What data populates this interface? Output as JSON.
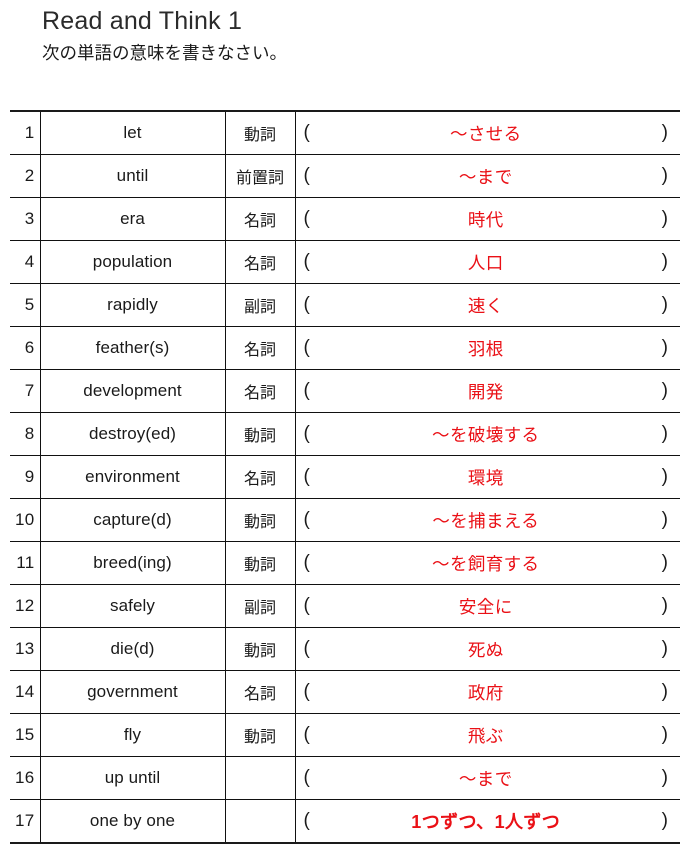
{
  "header": {
    "title": "Read and Think 1",
    "subtitle": "次の単語の意味を書きなさい。"
  },
  "style": {
    "answer_color": "#ea1016",
    "text_color": "#1a1a1a",
    "border_color": "#111111"
  },
  "table": {
    "paren_open": "(",
    "paren_close": ")",
    "rows": [
      {
        "num": "1",
        "word": "let",
        "pos": "動詞",
        "answer": "〜させる",
        "bold": false
      },
      {
        "num": "2",
        "word": "until",
        "pos": "前置詞",
        "answer": "〜まで",
        "bold": false
      },
      {
        "num": "3",
        "word": "era",
        "pos": "名詞",
        "answer": "時代",
        "bold": false
      },
      {
        "num": "4",
        "word": "population",
        "pos": "名詞",
        "answer": "人口",
        "bold": false
      },
      {
        "num": "5",
        "word": "rapidly",
        "pos": "副詞",
        "answer": "速く",
        "bold": false
      },
      {
        "num": "6",
        "word": "feather(s)",
        "pos": "名詞",
        "answer": "羽根",
        "bold": false
      },
      {
        "num": "7",
        "word": "development",
        "pos": "名詞",
        "answer": "開発",
        "bold": false
      },
      {
        "num": "8",
        "word": "destroy(ed)",
        "pos": "動詞",
        "answer": "〜を破壊する",
        "bold": false
      },
      {
        "num": "9",
        "word": "environment",
        "pos": "名詞",
        "answer": "環境",
        "bold": false
      },
      {
        "num": "10",
        "word": "capture(d)",
        "pos": "動詞",
        "answer": "〜を捕まえる",
        "bold": false
      },
      {
        "num": "11",
        "word": "breed(ing)",
        "pos": "動詞",
        "answer": "〜を飼育する",
        "bold": false
      },
      {
        "num": "12",
        "word": "safely",
        "pos": "副詞",
        "answer": "安全に",
        "bold": false
      },
      {
        "num": "13",
        "word": "die(d)",
        "pos": "動詞",
        "answer": "死ぬ",
        "bold": false
      },
      {
        "num": "14",
        "word": "government",
        "pos": "名詞",
        "answer": "政府",
        "bold": false
      },
      {
        "num": "15",
        "word": "fly",
        "pos": "動詞",
        "answer": "飛ぶ",
        "bold": false
      },
      {
        "num": "16",
        "word": "up until",
        "pos": "",
        "answer": "〜まで",
        "bold": false
      },
      {
        "num": "17",
        "word": "one by one",
        "pos": "",
        "answer": "1つずつ、1人ずつ",
        "bold": true
      }
    ]
  }
}
